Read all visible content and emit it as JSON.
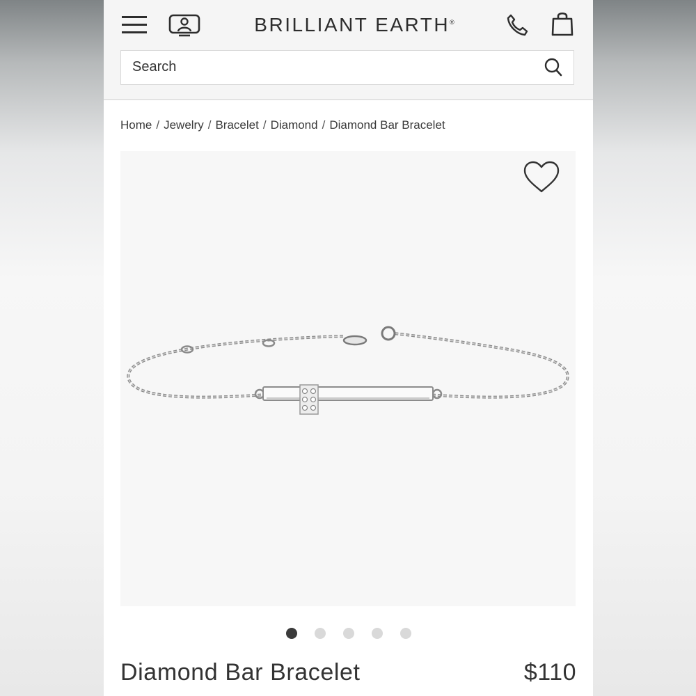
{
  "header": {
    "brand_name": "BRILLIANT EARTH",
    "brand_mark": "®",
    "icons": {
      "menu": "hamburger-menu-icon",
      "consult": "virtual-appointment-icon",
      "phone": "phone-icon",
      "bag": "shopping-bag-icon"
    }
  },
  "search": {
    "placeholder": "Search",
    "icon": "search-icon"
  },
  "breadcrumb": {
    "items": [
      "Home",
      "Jewelry",
      "Bracelet",
      "Diamond",
      "Diamond Bar Bracelet"
    ],
    "separator": "/"
  },
  "gallery": {
    "wishlist_icon": "heart-outline-icon",
    "image_subject": "silver chain bracelet with diamond bar",
    "slide_count": 5,
    "active_slide": 1
  },
  "product": {
    "title": "Diamond Bar Bracelet",
    "price": "$110"
  },
  "colors": {
    "text": "#2b2b2b",
    "header_bg": "#f5f5f5",
    "image_bg": "#f7f7f7",
    "dot_active": "#3b3b3b",
    "dot_inactive": "#d9d9d9"
  }
}
